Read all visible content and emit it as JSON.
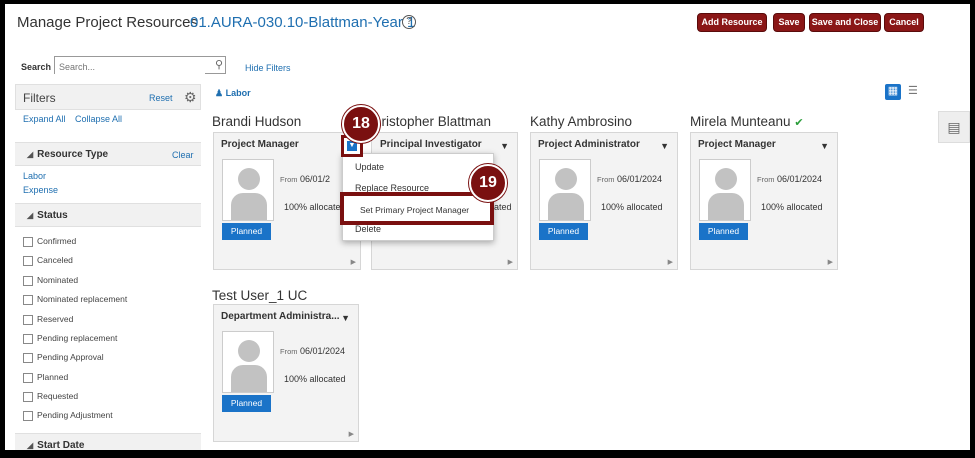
{
  "header": {
    "title": "Manage Project Resources",
    "project": "01.AURA-030.10-Blattman-Year 1",
    "help_icon": "?",
    "buttons": [
      "Add Resource",
      "Save",
      "Save and Close",
      "Cancel"
    ]
  },
  "search": {
    "label": "Search",
    "placeholder": "Search...",
    "hide_filters": "Hide Filters"
  },
  "filters": {
    "title": "Filters",
    "reset": "Reset",
    "expand_all": "Expand All",
    "collapse_all": "Collapse All",
    "resource_type": {
      "title": "Resource Type",
      "clear": "Clear",
      "items": [
        "Labor",
        "Expense"
      ]
    },
    "status": {
      "title": "Status",
      "items": [
        "Confirmed",
        "Canceled",
        "Nominated",
        "Nominated replacement",
        "Reserved",
        "Pending replacement",
        "Pending Approval",
        "Planned",
        "Requested",
        "Pending Adjustment"
      ]
    },
    "start_date": {
      "title": "Start Date"
    }
  },
  "labor_badge": "Labor",
  "cards": [
    {
      "name": "Brandi Hudson",
      "role": "Project Manager",
      "from_label": "From",
      "date": "06/01/2",
      "allocation": "100% allocated",
      "status": "Planned"
    },
    {
      "name": "hristopher Blattman",
      "role": "Principal Investigator",
      "allocation": "ated"
    },
    {
      "name": "Kathy Ambrosino",
      "role": "Project Administrator",
      "from_label": "From",
      "date": "06/01/2024",
      "allocation": "100% allocated",
      "status": "Planned"
    },
    {
      "name": "Mirela Munteanu",
      "role": "Project Manager",
      "from_label": "From",
      "date": "06/01/2024",
      "allocation": "100% allocated",
      "status": "Planned",
      "check_icon": "✔"
    },
    {
      "name": "Test User_1 UC",
      "role": "Department Administra...",
      "from_label": "From",
      "date": "06/01/2024",
      "allocation": "100% allocated",
      "status": "Planned"
    }
  ],
  "menu": {
    "items": [
      "Update",
      "Replace Resource",
      "Set Primary Project Manager",
      "Delete"
    ]
  },
  "steps": [
    "18",
    "19"
  ],
  "colors": {
    "accent_red": "#8a1616",
    "link_blue": "#1f6fb0",
    "primary_blue": "#1a73c8",
    "callout": "#7a1010"
  }
}
